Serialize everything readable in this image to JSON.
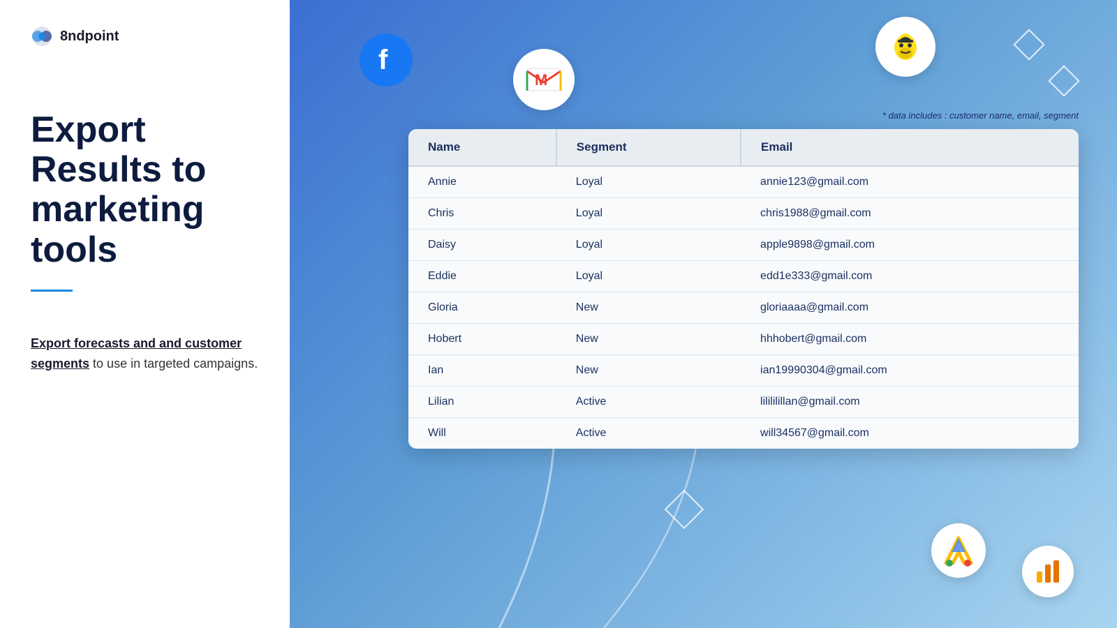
{
  "brand": {
    "name": "8ndpoint",
    "logo_alt": "8ndpoint logo"
  },
  "left": {
    "heading_line1": "Export",
    "heading_line2": "Results",
    "heading_suffix": " to",
    "heading_line3": "marketing tools",
    "divider": true,
    "description_linked": "Export forecasts and and customer segments",
    "description_rest": " to use in targeted campaigns."
  },
  "right": {
    "data_note": "* data includes : customer name, email, segment",
    "table": {
      "columns": [
        "Name",
        "Segment",
        "Email"
      ],
      "rows": [
        [
          "Annie",
          "Loyal",
          "annie123@gmail.com"
        ],
        [
          "Chris",
          "Loyal",
          "chris1988@gmail.com"
        ],
        [
          "Daisy",
          "Loyal",
          "apple9898@gmail.com"
        ],
        [
          "Eddie",
          "Loyal",
          "edd1e333@gmail.com"
        ],
        [
          "Gloria",
          "New",
          "gloriaaaa@gmail.com"
        ],
        [
          "Hobert",
          "New",
          "hhhobert@gmail.com"
        ],
        [
          "Ian",
          "New",
          "ian19990304@gmail.com"
        ],
        [
          "Lilian",
          "Active",
          "lilililillan@gmail.com"
        ],
        [
          "Will",
          "Active",
          "will34567@gmail.com"
        ]
      ]
    }
  }
}
